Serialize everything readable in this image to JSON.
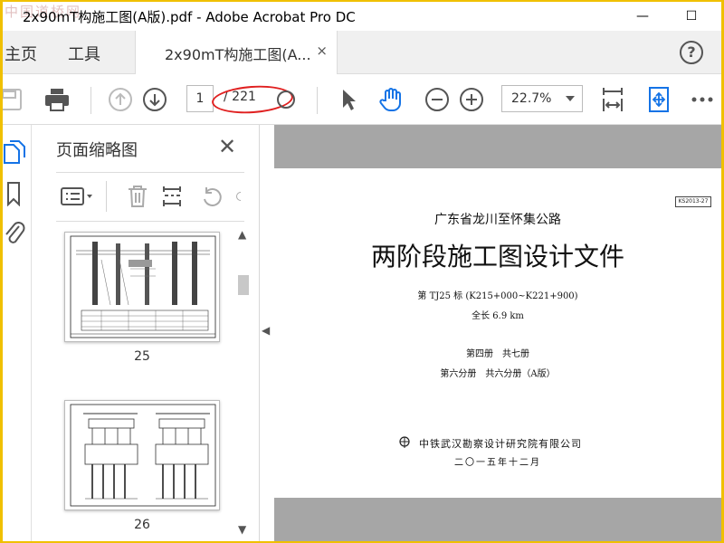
{
  "watermark": "中国道桥网",
  "window": {
    "title": "2x90mT构施工图(A版).pdf - Adobe Acrobat Pro DC",
    "minimize": "—",
    "maximize": "☐"
  },
  "tabs": {
    "home": "主页",
    "tools": "工具",
    "document": "2x90mT构施工图(A...",
    "close": "×",
    "help": "?"
  },
  "toolbar": {
    "current_page": "1",
    "total_pages": "/ 221",
    "zoom": "22.7%"
  },
  "panel": {
    "title": "页面缩略图",
    "close": "✕",
    "thumbnails": [
      {
        "label": "25"
      },
      {
        "label": "26"
      }
    ]
  },
  "document": {
    "code": "KS2013-27",
    "project": "广东省龙川至怀集公路",
    "heading": "两阶段施工图设计文件",
    "section": "第 TJ25 标 (K215+000~K221+900)",
    "length": "全长 6.9 km",
    "volume": "第四册　共七册",
    "subvolume": "第六分册　共六分册（A版）",
    "org": "中铁武汉勘察设计研究院有限公司",
    "date": "二〇一五年十二月"
  },
  "colors": {
    "accent_blue": "#1473e6",
    "highlight_red": "#e02020",
    "frame_yellow": "#f0c000",
    "doc_background": "#a6a6a6"
  }
}
